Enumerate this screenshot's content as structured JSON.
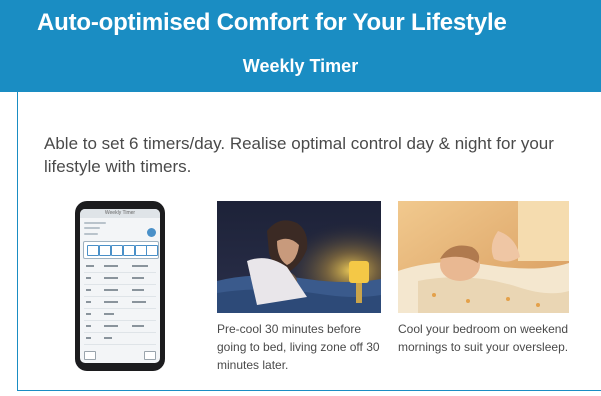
{
  "header": {
    "title": "Auto-optimised Comfort for Your Lifestyle",
    "subtitle": "Weekly Timer"
  },
  "intro": {
    "text": "Able to set 6 timers/day. Realise optimal control day & night for your lifestyle with timers."
  },
  "phone": {
    "status_text": "Weekly Timer"
  },
  "captions": [
    {
      "text": "Pre-cool 30 minutes before going to bed, living zone off 30 minutes later."
    },
    {
      "text": "Cool your bedroom on weekend mornings to suit your oversleep."
    }
  ],
  "colors": {
    "brand_blue": "#1a8dc3",
    "text_gray": "#4a4a4a"
  }
}
